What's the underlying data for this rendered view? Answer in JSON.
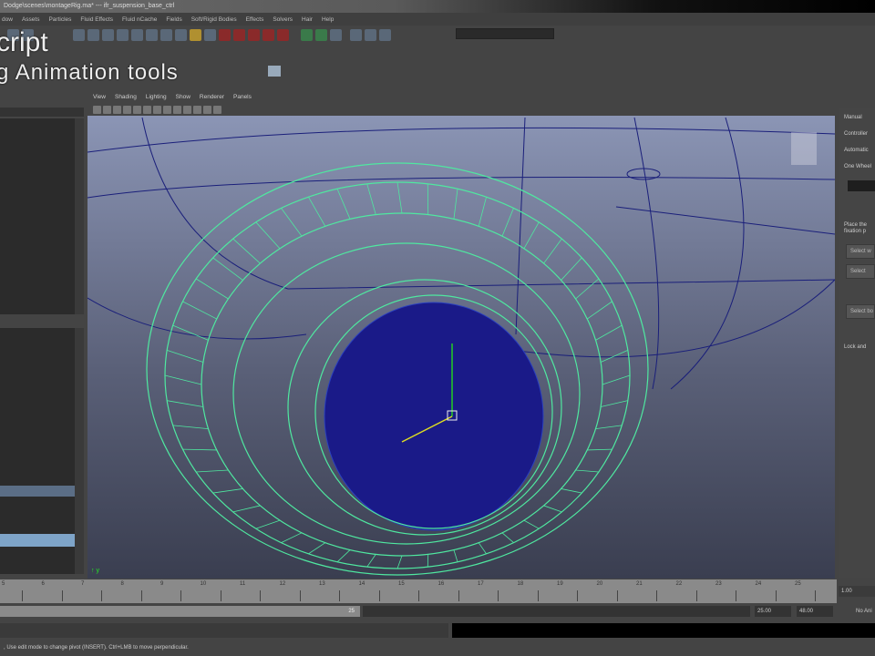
{
  "window": {
    "title": "Dodge\\scenes\\montageRig.ma*  ---  ifr_suspension_base_ctrl"
  },
  "menu": [
    "dow",
    "Assets",
    "Particles",
    "Fluid Effects",
    "Fluid nCache",
    "Fields",
    "Soft/Rigid Bodies",
    "Effects",
    "Solvers",
    "Hair",
    "Help"
  ],
  "overlay": {
    "line1": "cript",
    "line2": "g Animation tools"
  },
  "viewport_menu": [
    "View",
    "Shading",
    "Lighting",
    "Show",
    "Renderer",
    "Panels"
  ],
  "right_panel": {
    "tabs": [
      "Manual",
      "Controller",
      "Automatic"
    ],
    "section": "One Wheel",
    "instruction": "Place the fixation p",
    "buttons": [
      "Select w",
      "Select",
      "Select bo",
      "Lock and"
    ]
  },
  "timeline": {
    "ticks": [
      "5",
      "6",
      "7",
      "8",
      "9",
      "10",
      "11",
      "12",
      "13",
      "14",
      "15",
      "16",
      "17",
      "18",
      "19",
      "20",
      "21",
      "22",
      "23",
      "24",
      "25"
    ],
    "current_frame": "1.00"
  },
  "range": {
    "end_label": "25",
    "start": "25.00",
    "end": "48.00",
    "anim_layer": "No Ani"
  },
  "help_line": ", Use edit mode to change pivot (INSERT). Ctrl+LMB to move perpendicular."
}
